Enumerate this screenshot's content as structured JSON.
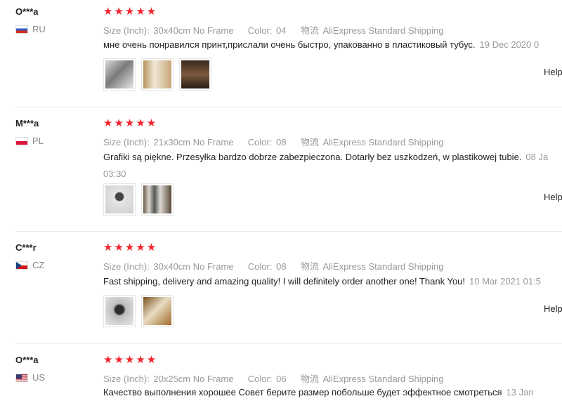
{
  "reviews": [
    {
      "user": "O***a",
      "country": "RU",
      "stars": "★★★★★",
      "size_label": "Size (Inch):",
      "size_value": "30x40cm No Frame",
      "color_label": "Color:",
      "color_value": "04",
      "ship_label": "物流",
      "ship_value": "AliExpress Standard Shipping",
      "comment": "мне очень понравился принт,прислали очень быстро, упакованно в пластиковый тубус.",
      "date": "19 Dec 2020 0",
      "helpful": "Help"
    },
    {
      "user": "M***a",
      "country": "PL",
      "stars": "★★★★★",
      "size_label": "Size (Inch):",
      "size_value": "21x30cm No Frame",
      "color_label": "Color:",
      "color_value": "08",
      "ship_label": "物流",
      "ship_value": "AliExpress Standard Shipping",
      "comment": "Grafiki są piękne. Przesyłka bardzo dobrze zabezpieczona. Dotarły bez uszkodzeń, w plastikowej tubie.",
      "date": "08 Ja 03:30",
      "helpful": "Help"
    },
    {
      "user": "C***r",
      "country": "CZ",
      "stars": "★★★★★",
      "size_label": "Size (Inch):",
      "size_value": "30x40cm No Frame",
      "color_label": "Color:",
      "color_value": "08",
      "ship_label": "物流",
      "ship_value": "AliExpress Standard Shipping",
      "comment": "Fast shipping, delivery and amazing quality! I will definitely order another one! Thank You!",
      "date": "10 Mar 2021 01:5",
      "helpful": "Help"
    },
    {
      "user": "O***a",
      "country": "US",
      "stars": "★★★★★",
      "size_label": "Size (Inch):",
      "size_value": "20x25cm No Frame",
      "color_label": "Color:",
      "color_value": "06",
      "ship_label": "物流",
      "ship_value": "AliExpress Standard Shipping",
      "comment": "Качество выполнения хорошее Совет берите размер побольше будет эффектное смотреться",
      "date": "13 Jan"
    }
  ]
}
